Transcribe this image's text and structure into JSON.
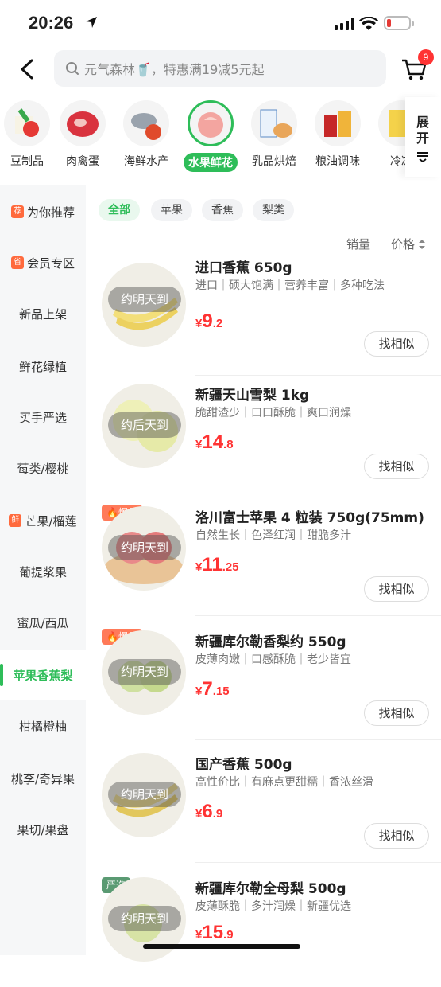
{
  "status_bar": {
    "time": "20:26"
  },
  "search": {
    "placeholder": "元气森林🥤，特惠满19减5元起"
  },
  "cart": {
    "count": "9"
  },
  "categories": [
    {
      "label": "豆制品"
    },
    {
      "label": "肉禽蛋"
    },
    {
      "label": "海鲜水产"
    },
    {
      "label": "水果鲜花",
      "active": true
    },
    {
      "label": "乳品烘焙"
    },
    {
      "label": "粮油调味"
    },
    {
      "label": "冷冻"
    }
  ],
  "expand_label": "展开",
  "sidebar": [
    {
      "label": "为你推荐",
      "tag": "荐"
    },
    {
      "label": "会员专区",
      "tag": "省"
    },
    {
      "label": "新品上架"
    },
    {
      "label": "鲜花绿植"
    },
    {
      "label": "买手严选"
    },
    {
      "label": "莓类/樱桃"
    },
    {
      "label": "芒果/榴莲",
      "tag": "鲜"
    },
    {
      "label": "葡提浆果"
    },
    {
      "label": "蜜瓜/西瓜"
    },
    {
      "label": "苹果香蕉梨",
      "active": true
    },
    {
      "label": "柑橘橙柚"
    },
    {
      "label": "桃李/奇异果"
    },
    {
      "label": "果切/果盘"
    }
  ],
  "filter_chips": [
    "全部",
    "苹果",
    "香蕉",
    "梨类"
  ],
  "sort": {
    "sales": "销量",
    "price": "价格"
  },
  "products": [
    {
      "title": "进口香蕉 650g",
      "desc": "进口｜硕大饱满｜营养丰富｜多种吃法",
      "eta": "约明天到",
      "price_int": "9",
      "price_dec": ".2",
      "button": "找相似",
      "badge": ""
    },
    {
      "title": "新疆天山雪梨 1kg",
      "desc": "脆甜渣少｜口口酥脆｜爽口润燥",
      "eta": "约后天到",
      "price_int": "14",
      "price_dec": ".8",
      "button": "找相似",
      "badge": ""
    },
    {
      "title": "洛川富士苹果 4 粒装 750g(75mm)",
      "desc": "自然生长｜色泽红润｜甜脆多汁",
      "eta": "约明天到",
      "price_int": "11",
      "price_dec": ".25",
      "button": "找相似",
      "badge": "爆品"
    },
    {
      "title": "新疆库尔勒香梨约 550g",
      "desc": "皮薄肉嫩｜口感酥脆｜老少皆宜",
      "eta": "约明天到",
      "price_int": "7",
      "price_dec": ".15",
      "button": "找相似",
      "badge": "爆品"
    },
    {
      "title": "国产香蕉  500g",
      "desc": "高性价比｜有麻点更甜糯｜香浓丝滑",
      "eta": "约明天到",
      "price_int": "6",
      "price_dec": ".9",
      "button": "找相似",
      "badge": ""
    },
    {
      "title": "新疆库尔勒全母梨 500g",
      "desc": "皮薄酥脆｜多汁润燥｜新疆优选",
      "eta": "约明天到",
      "price_int": "15",
      "price_dec": ".9",
      "button": "找相似",
      "badge": "严选"
    }
  ],
  "currency": "¥"
}
